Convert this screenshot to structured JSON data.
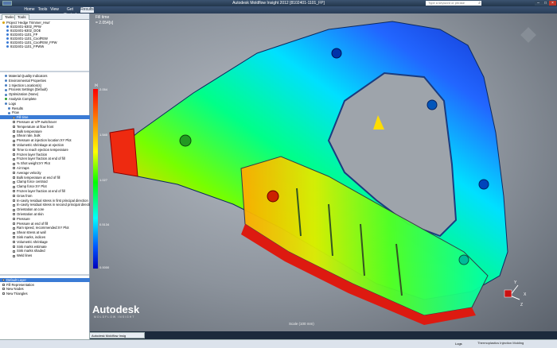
{
  "titlebar": {
    "title": "Autodesk Moldflow Insight 2012     [8102401-1101_FP]",
    "search_placeholder": "Type a keyword or phrase",
    "active_view": "Active View"
  },
  "menu": [
    "Home",
    "Tools",
    "View",
    "Get Started",
    "Results"
  ],
  "menu_active_index": 4,
  "panel_tabs": [
    "Tasks",
    "Tools"
  ],
  "projects": [
    "Project 'Hedge Trimmer_Hwx'",
    "8102401-6302_PPW",
    "8102401-6302_DOE",
    "8102401-1101_FP",
    "8102401-1101_CoolFEW",
    "8102401-1101_CoolFEW_FPW",
    "8102401-1101_FPWW"
  ],
  "tasks": [
    "Material Quality Indicators",
    "Environmental Properties",
    "1 Injection Location(s)",
    "Process Settings (Default)",
    "Optimization (None)",
    "Analysis Complete",
    "Logs",
    "Results",
    "Flow",
    "Fill time",
    "Pressure at V/P switchover",
    "Temperature at flow front",
    "Bulk temperature",
    "Shear rate, bulk",
    "Pressure at injection location:XY Plot",
    "Volumetric shrinkage at ejection",
    "Time to reach ejection temperature",
    "Frozen layer fraction",
    "Frozen layer fraction at end of fill",
    "% Shot weight:XY Plot",
    "Air traps",
    "Average velocity",
    "Bulk temperature at end of fill",
    "Clamp force centroid",
    "Clamp force:XY Plot",
    "Frozen layer fraction at end of fill",
    "Grow from",
    "In-cavity residual stress in first principal direction",
    "In-cavity residual stress in second principal direction",
    "Orientation at core",
    "Orientation at skin",
    "Pressure",
    "Pressure at end of fill",
    "Ram speed, recommended:XY Plot",
    "Shear stress at wall",
    "Sink marks, indices",
    "Volumetric shrinkage",
    "Sink marks estimate",
    "Sink marks shaded",
    "Weld lines"
  ],
  "selected_task_index": 9,
  "layers": [
    "Default Layer",
    "Fill Representation",
    "New Nodes",
    "New Triangles"
  ],
  "viewport": {
    "plot_title": "Fill time",
    "plot_subtitle": "= 2.054[s]",
    "legend_unit": "[s]",
    "legend_values": [
      "2.054",
      "1.540",
      "1.027",
      "0.5134",
      "0.0000"
    ],
    "scale_label": "Scale (100 mm)",
    "axis_labels": [
      "Y",
      "Z",
      "X"
    ]
  },
  "logo": {
    "brand": "Autodesk",
    "product": "MOLDFLOW INSIGHT"
  },
  "taskbar_tab": "Autodesk Moldflow Insig",
  "statusbar": {
    "mode": "Thermoplastics Injection Molding",
    "logs": "Logs"
  },
  "colors": {
    "accent": "#3a7bd5",
    "titlebar": "#2b3f58",
    "results_tab": "#e8eef6"
  }
}
